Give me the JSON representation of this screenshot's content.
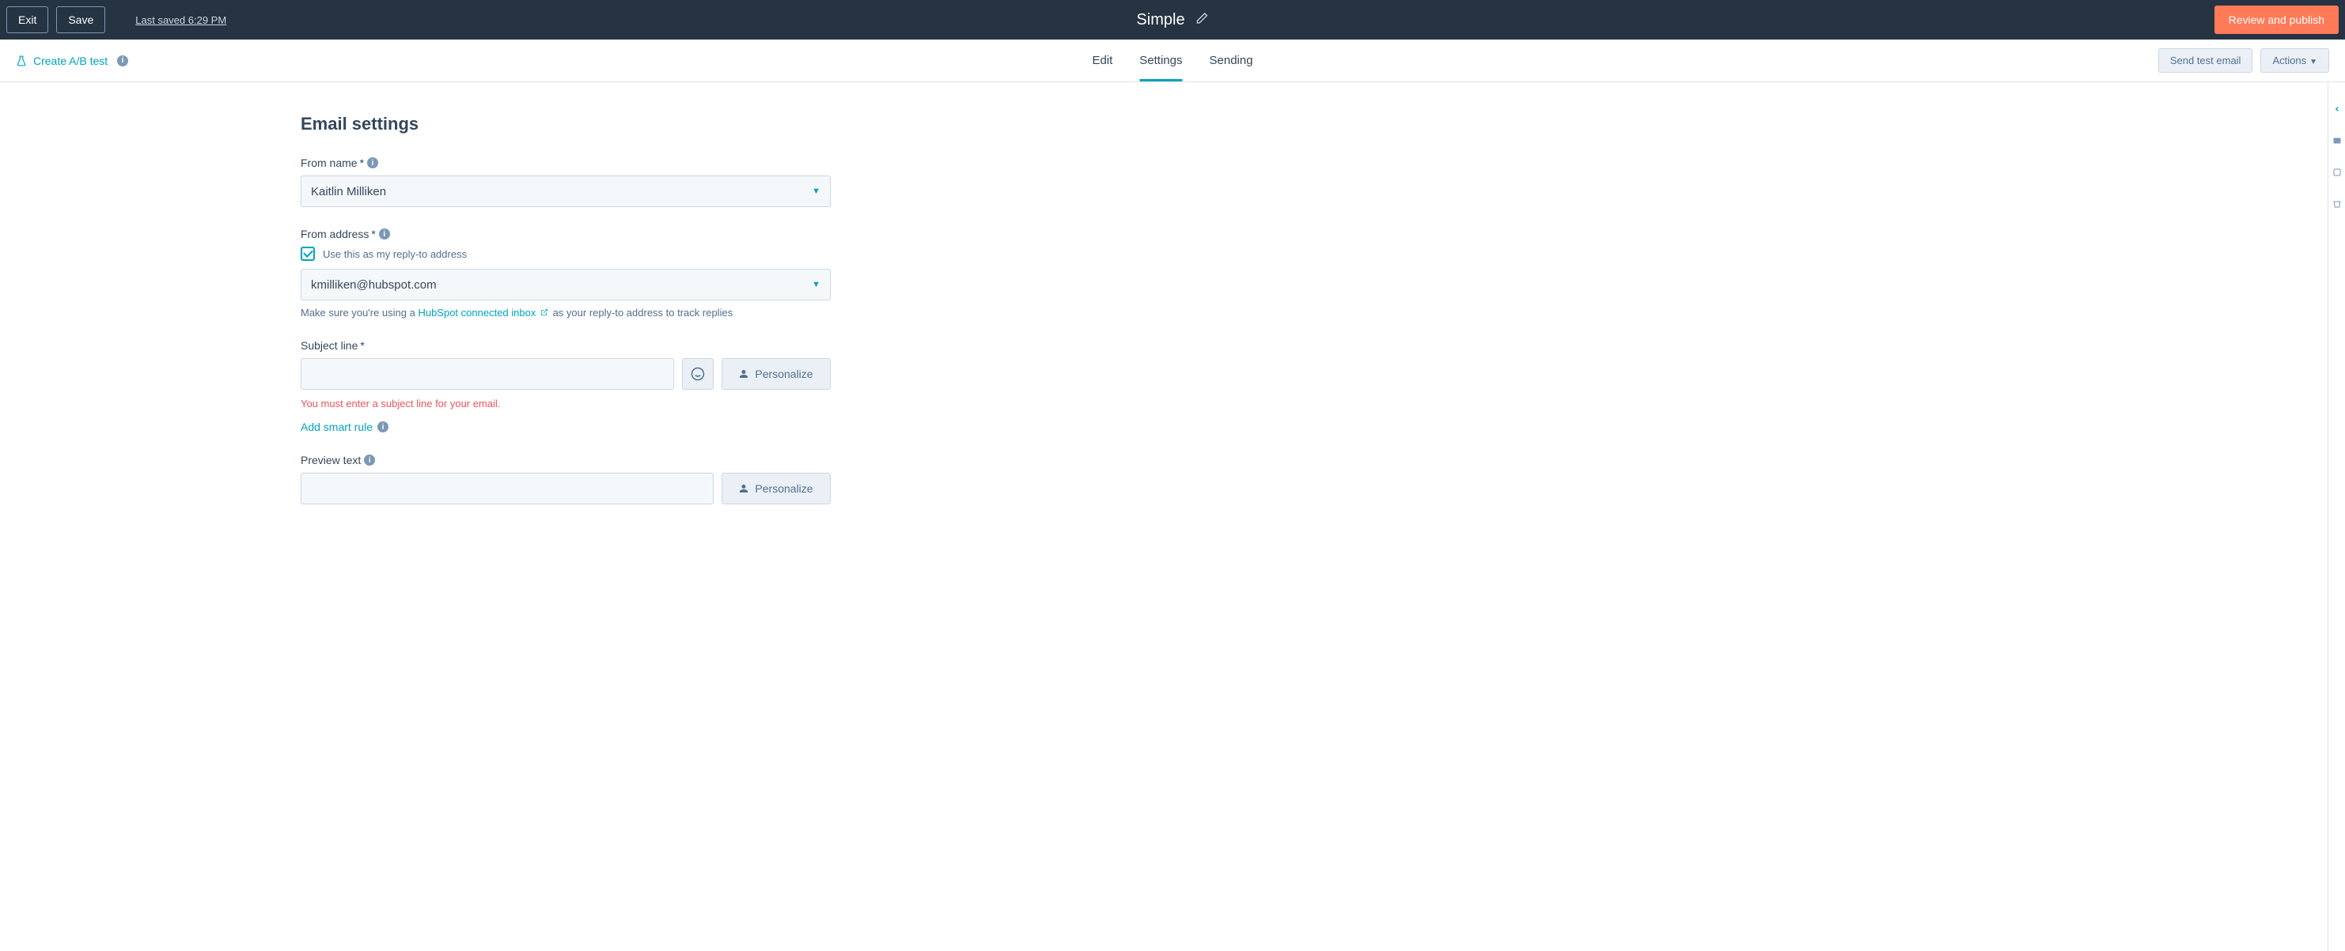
{
  "topbar": {
    "exit": "Exit",
    "save": "Save",
    "last_saved": "Last saved 6:29 PM",
    "title": "Simple",
    "review_publish": "Review and publish"
  },
  "subbar": {
    "ab_test": "Create A/B test",
    "tabs": {
      "edit": "Edit",
      "settings": "Settings",
      "sending": "Sending"
    },
    "send_test": "Send test email",
    "actions": "Actions"
  },
  "settings": {
    "title": "Email settings",
    "from_name": {
      "label": "From name",
      "value": "Kaitlin Milliken"
    },
    "from_address": {
      "label": "From address",
      "checkbox_label": "Use this as my reply-to address",
      "value": "kmilliken@hubspot.com",
      "help_pre": "Make sure you're using a ",
      "help_link": "HubSpot connected inbox",
      "help_post": " as your reply-to address to track replies"
    },
    "subject": {
      "label": "Subject line",
      "error": "You must enter a subject line for your email.",
      "smart_rule": "Add smart rule",
      "personalize": "Personalize"
    },
    "preview": {
      "label": "Preview text",
      "personalize": "Personalize"
    }
  }
}
